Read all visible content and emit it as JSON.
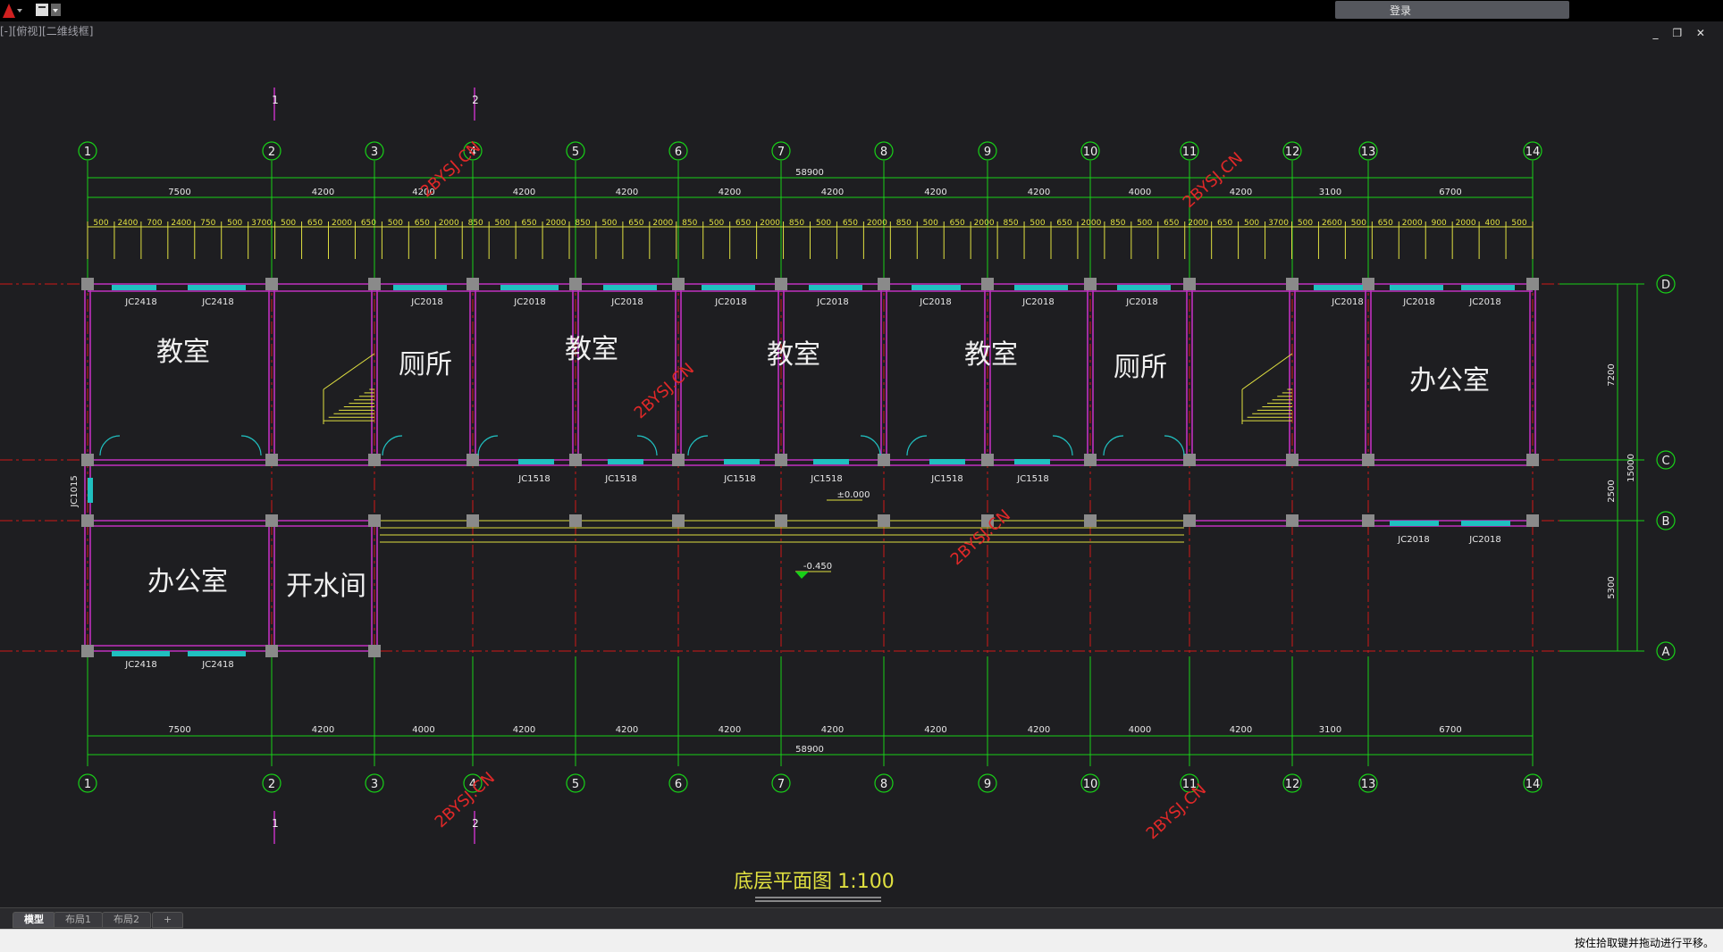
{
  "window": {
    "view_title": "[-][俯视][二维线框]",
    "login_label": "登录",
    "controls": "_ ❐ ✕"
  },
  "watermark": "2BYSJ.CN",
  "drawing": {
    "title": "底层平面图",
    "scale": "1:100",
    "axes_numbers": [
      "1",
      "2",
      "3",
      "4",
      "5",
      "6",
      "7",
      "8",
      "9",
      "10",
      "11",
      "12",
      "13",
      "14"
    ],
    "axes_letters": [
      "D",
      "C",
      "B",
      "A"
    ],
    "section_marks": [
      "1",
      "2"
    ],
    "dims_top_main": [
      "7500",
      "4200",
      "4200",
      "4200",
      "4200",
      "4200",
      "4200",
      "4200",
      "4000",
      "4200",
      "3100",
      "6700"
    ],
    "dims_bottom_main": [
      "7500",
      "4200",
      "4000",
      "4200",
      "4200",
      "4200",
      "4200",
      "4200",
      "4200",
      "4000",
      "4200",
      "3100",
      "6700"
    ],
    "overall": "58900",
    "right_dims": [
      "7200",
      "2500",
      "5300"
    ],
    "right_total": "15000",
    "left_label": "JC1015",
    "levels": [
      "±0.000",
      "-0.450"
    ],
    "rooms_top": [
      "教室",
      "厕所",
      "教室",
      "教室",
      "教室",
      "厕所",
      "办公室"
    ],
    "rooms_bottom": [
      "办公室",
      "开水间"
    ],
    "windows_top": [
      "JC2418",
      "JC2418",
      "JC2018",
      "JC2018",
      "JC2018",
      "JC2018",
      "JC2018",
      "JC2018",
      "JC2018",
      "JC2018",
      "JC2018",
      "JC2018"
    ],
    "windows_corr": [
      "JC1518",
      "JC1518",
      "JC1518",
      "JC1518",
      "JC1518",
      "JC1518"
    ],
    "windows_b": [
      "JC2018",
      "JC2018"
    ],
    "windows_bottom": [
      "JC2418",
      "JC2418"
    ],
    "detail_dims": [
      "500",
      "2400",
      "700",
      "2400",
      "750",
      "500",
      "3700",
      "500",
      "650",
      "2000",
      "650",
      "500",
      "650",
      "2000",
      "850",
      "500",
      "650",
      "2000",
      "850",
      "500",
      "650",
      "2000",
      "850",
      "500",
      "650",
      "2000",
      "850",
      "500",
      "650",
      "2000",
      "850",
      "500",
      "650",
      "2000",
      "850",
      "500",
      "650",
      "2000",
      "850",
      "500",
      "650",
      "2000",
      "650",
      "500",
      "3700",
      "500",
      "2600",
      "500",
      "650",
      "2000",
      "900",
      "2000",
      "400",
      "500"
    ]
  },
  "tabs": [
    "模型",
    "布局1",
    "布局2",
    "+"
  ],
  "status": "按住拾取键并拖动进行平移。"
}
